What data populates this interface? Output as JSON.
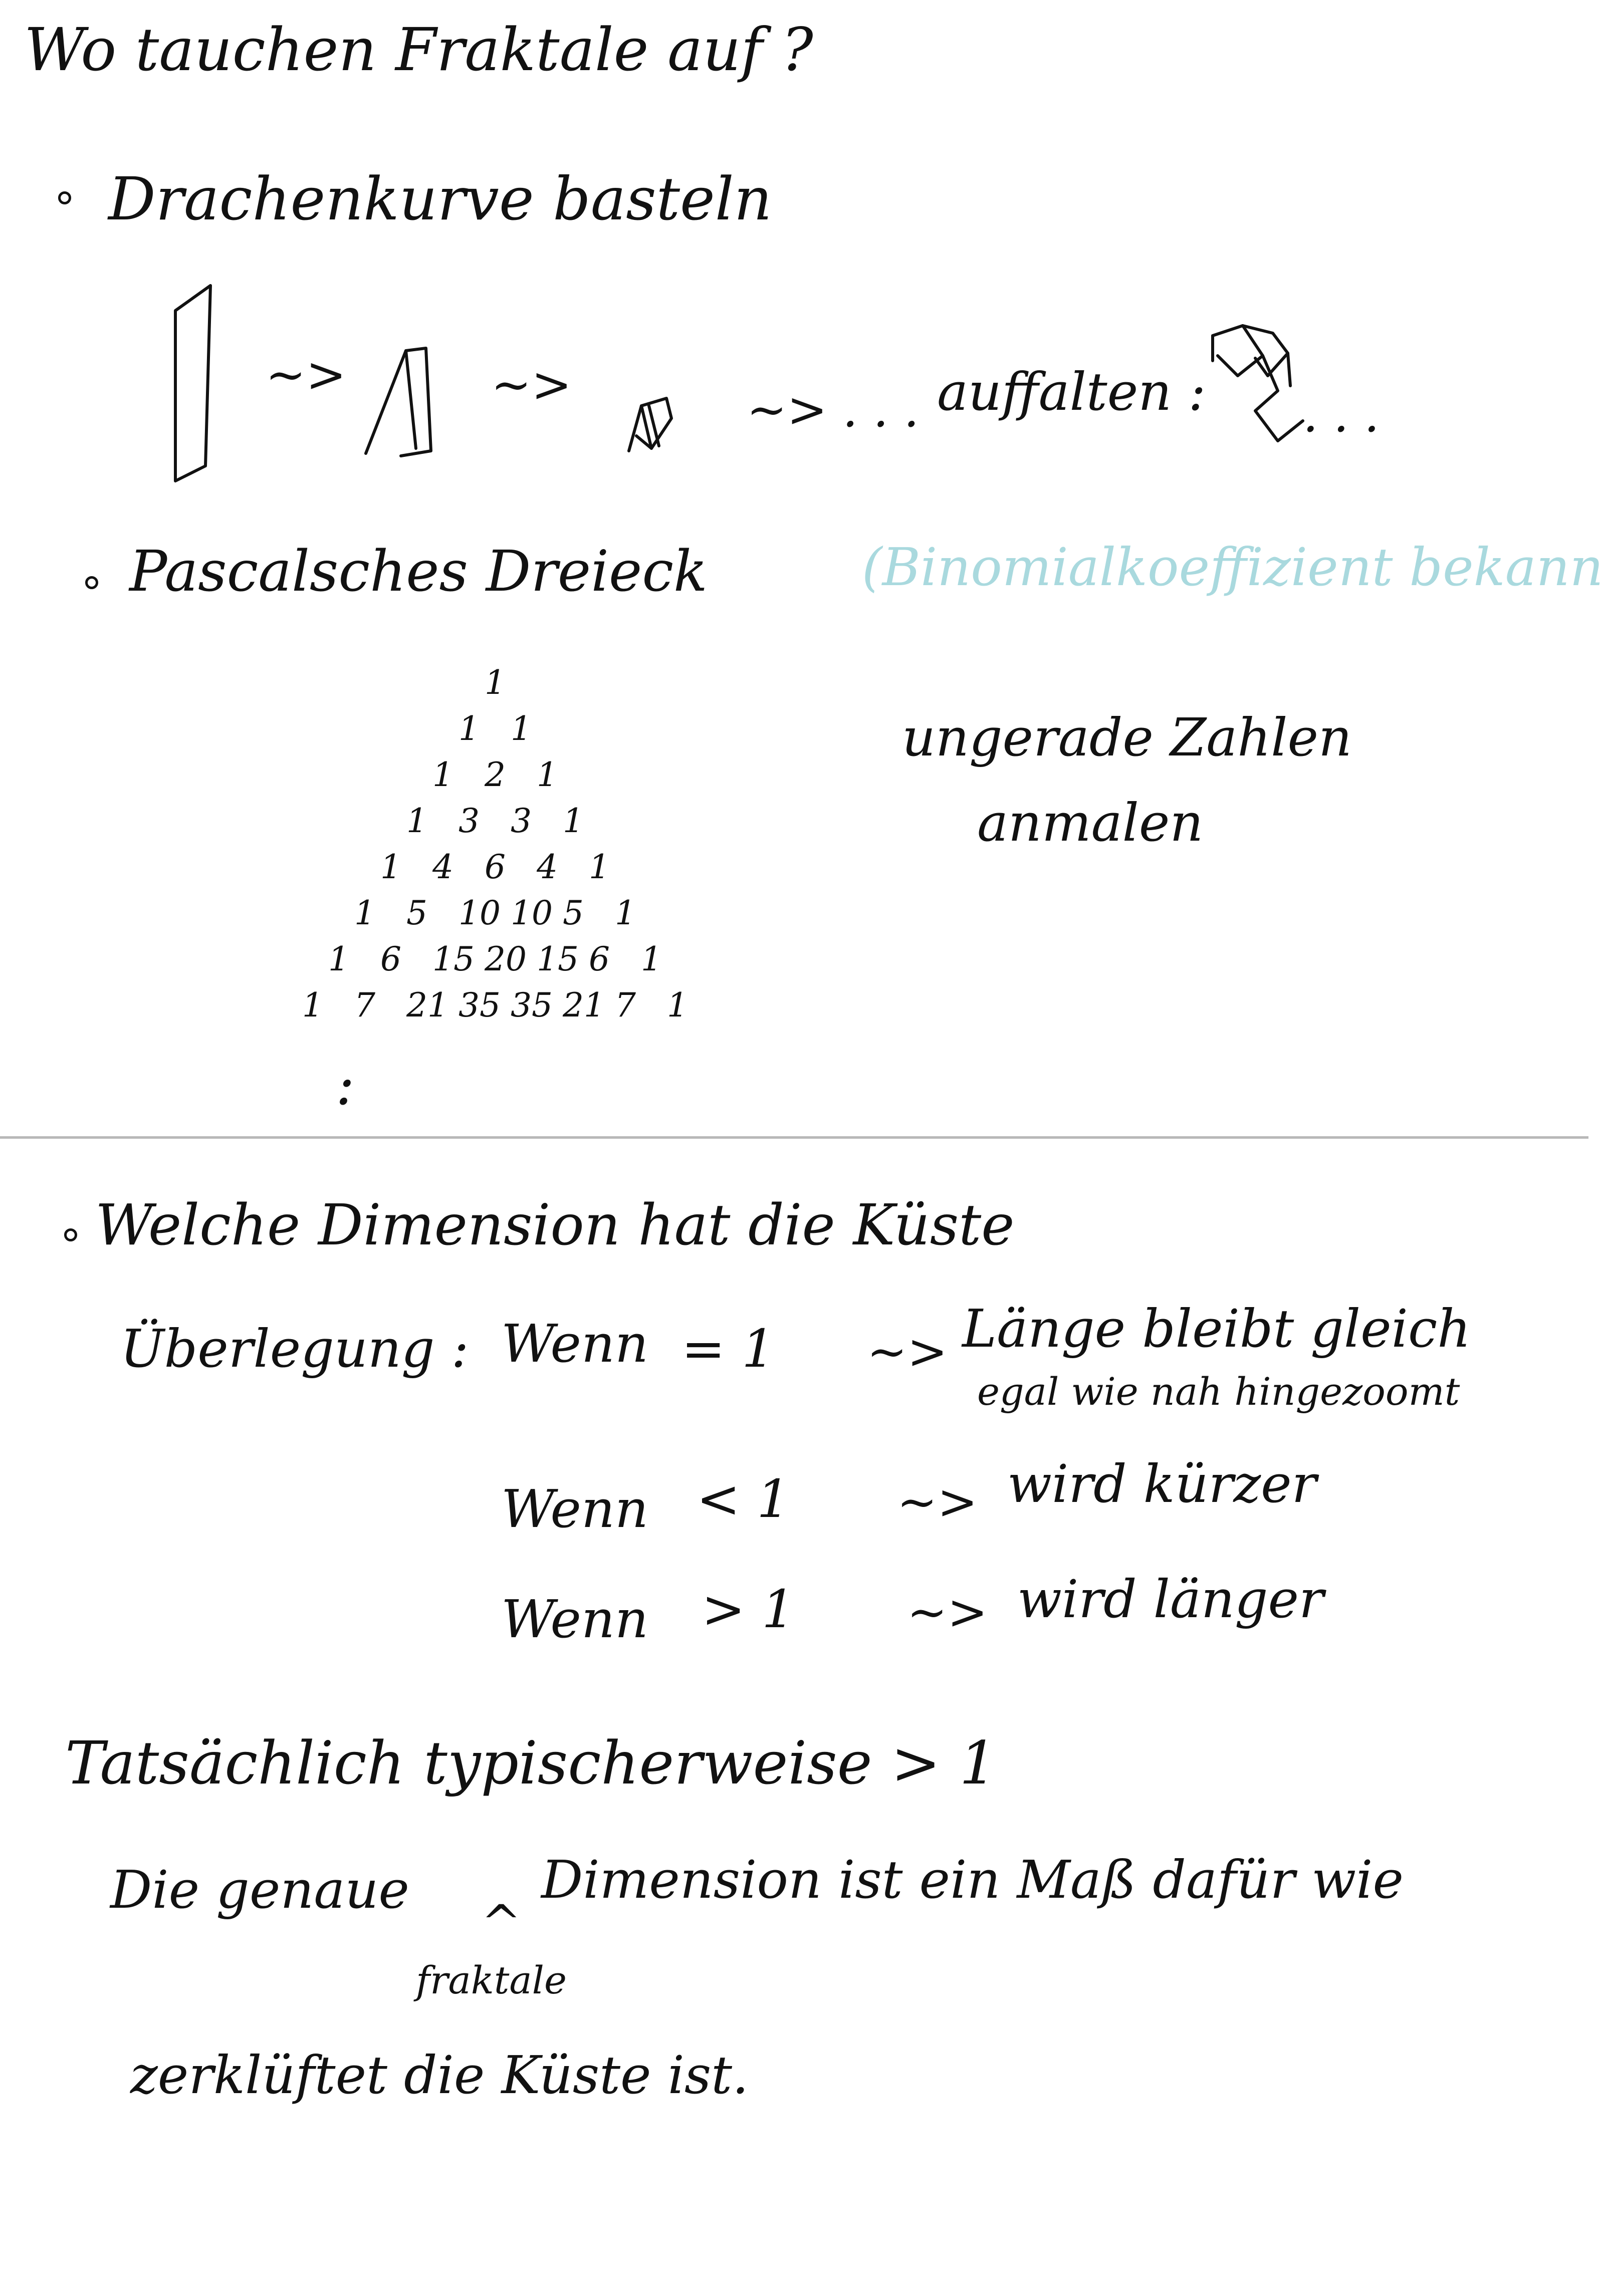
{
  "title": "Wo tauchen Fraktale auf ?",
  "section1": {
    "heading": "Drachenkurve basteln",
    "arrow1": "~>",
    "arrow2": "~>",
    "arrow3": "~> . . .",
    "unfold_label": "auffalten :",
    "ellipsis": ". . ."
  },
  "section2": {
    "heading": "Pascalsches Dreieck",
    "note": "(Binomialkoeffizient bekannt?)",
    "note_color": "#a9d9de",
    "instruction_line1": "ungerade Zahlen",
    "instruction_line2": "anmalen",
    "triangle_rows": [
      [
        "1"
      ],
      [
        "1",
        "1"
      ],
      [
        "1",
        "2",
        "1"
      ],
      [
        "1",
        "3",
        "3",
        "1"
      ],
      [
        "1",
        "4",
        "6",
        "4",
        "1"
      ],
      [
        "1",
        "5",
        "10",
        "10",
        "5",
        "1"
      ],
      [
        "1",
        "6",
        "15",
        "20",
        "15",
        "6",
        "1"
      ],
      [
        "1",
        "7",
        "21",
        "35",
        "35",
        "21",
        "7",
        "1"
      ]
    ],
    "continuation": ":"
  },
  "section3": {
    "heading": "Welche Dimension hat die Küste",
    "consideration_label": "Überlegung :",
    "rows": [
      {
        "cond": "Wenn",
        "op": "= 1",
        "arrow": "~>",
        "result": "Länge bleibt gleich",
        "subnote": "egal wie nah hingezoomt"
      },
      {
        "cond": "Wenn",
        "op": "< 1",
        "arrow": "~>",
        "result": "wird kürzer",
        "subnote": ""
      },
      {
        "cond": "Wenn",
        "op": "> 1",
        "arrow": "~>",
        "result": "wird länger",
        "subnote": ""
      }
    ]
  },
  "conclusion": {
    "line1": "Tatsächlich typischerweise > 1",
    "line2a": "Die genaue",
    "caret": "^",
    "insert": "fraktale",
    "line2b": "Dimension ist ein Maß dafür wie",
    "line3": "zerklüftet die Küste ist."
  }
}
